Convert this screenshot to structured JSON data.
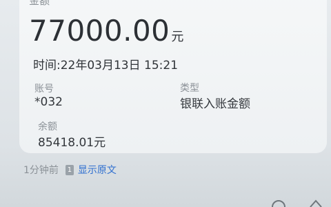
{
  "card": {
    "amount_title": "金额",
    "amount_value": "77000.00",
    "amount_unit": "元",
    "time": "时间:22年03月13日 15:21",
    "account_label": "账号",
    "account_value": "*032",
    "type_label": "类型",
    "type_value": "银联入账金额",
    "balance_label": "余额",
    "balance_value": "85418.01元"
  },
  "footer": {
    "time_ago": "1分钟前",
    "sim_badge": "1",
    "show_original": "显示原文"
  },
  "icons": [
    "sim-card-icon",
    "share-icon",
    "send-icon"
  ]
}
